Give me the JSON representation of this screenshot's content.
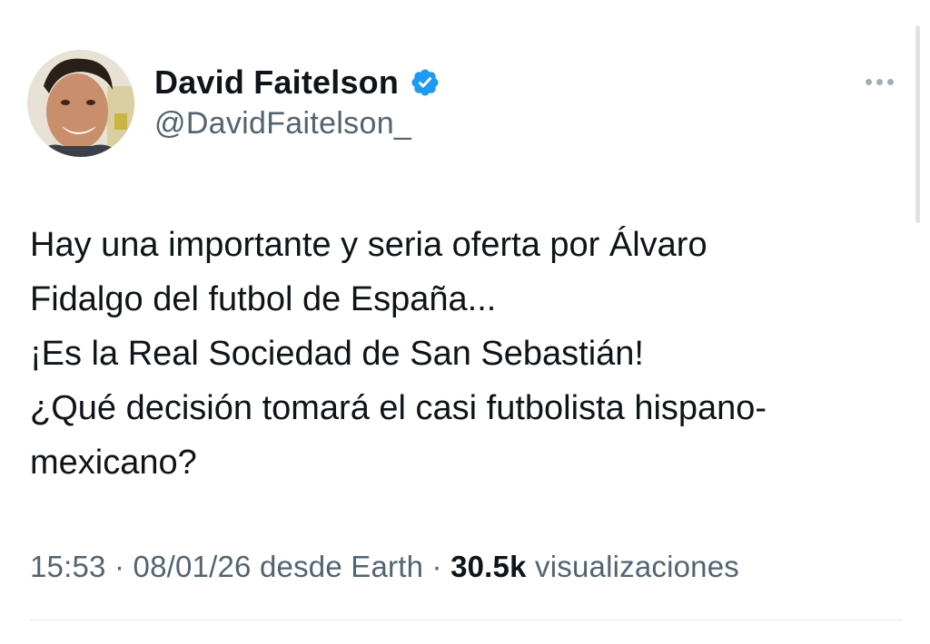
{
  "tweet": {
    "author": {
      "display_name": "David Faitelson",
      "handle": "@DavidFaitelson_",
      "verified": true,
      "avatar_icon": "profile-photo",
      "verified_icon": "verified-badge-icon"
    },
    "more_icon": "more-options-icon",
    "text_lines": [
      "Hay una importante y seria oferta por Álvaro",
      "Fidalgo del futbol de España...",
      "¡Es la Real Sociedad de San Sebastián!",
      "¿Qué decisión tomará el casi futbolista hispano-",
      "mexicano?"
    ],
    "meta": {
      "time": "15:53",
      "date": "08/01/26",
      "source": "desde Earth",
      "separator": " · ",
      "views_count": "30.5k",
      "views_label": "visualizaciones"
    }
  },
  "colors": {
    "text_primary": "#0f1419",
    "text_secondary": "#536471",
    "verified_blue": "#1d9bf0",
    "divider": "#e6e9eb"
  }
}
